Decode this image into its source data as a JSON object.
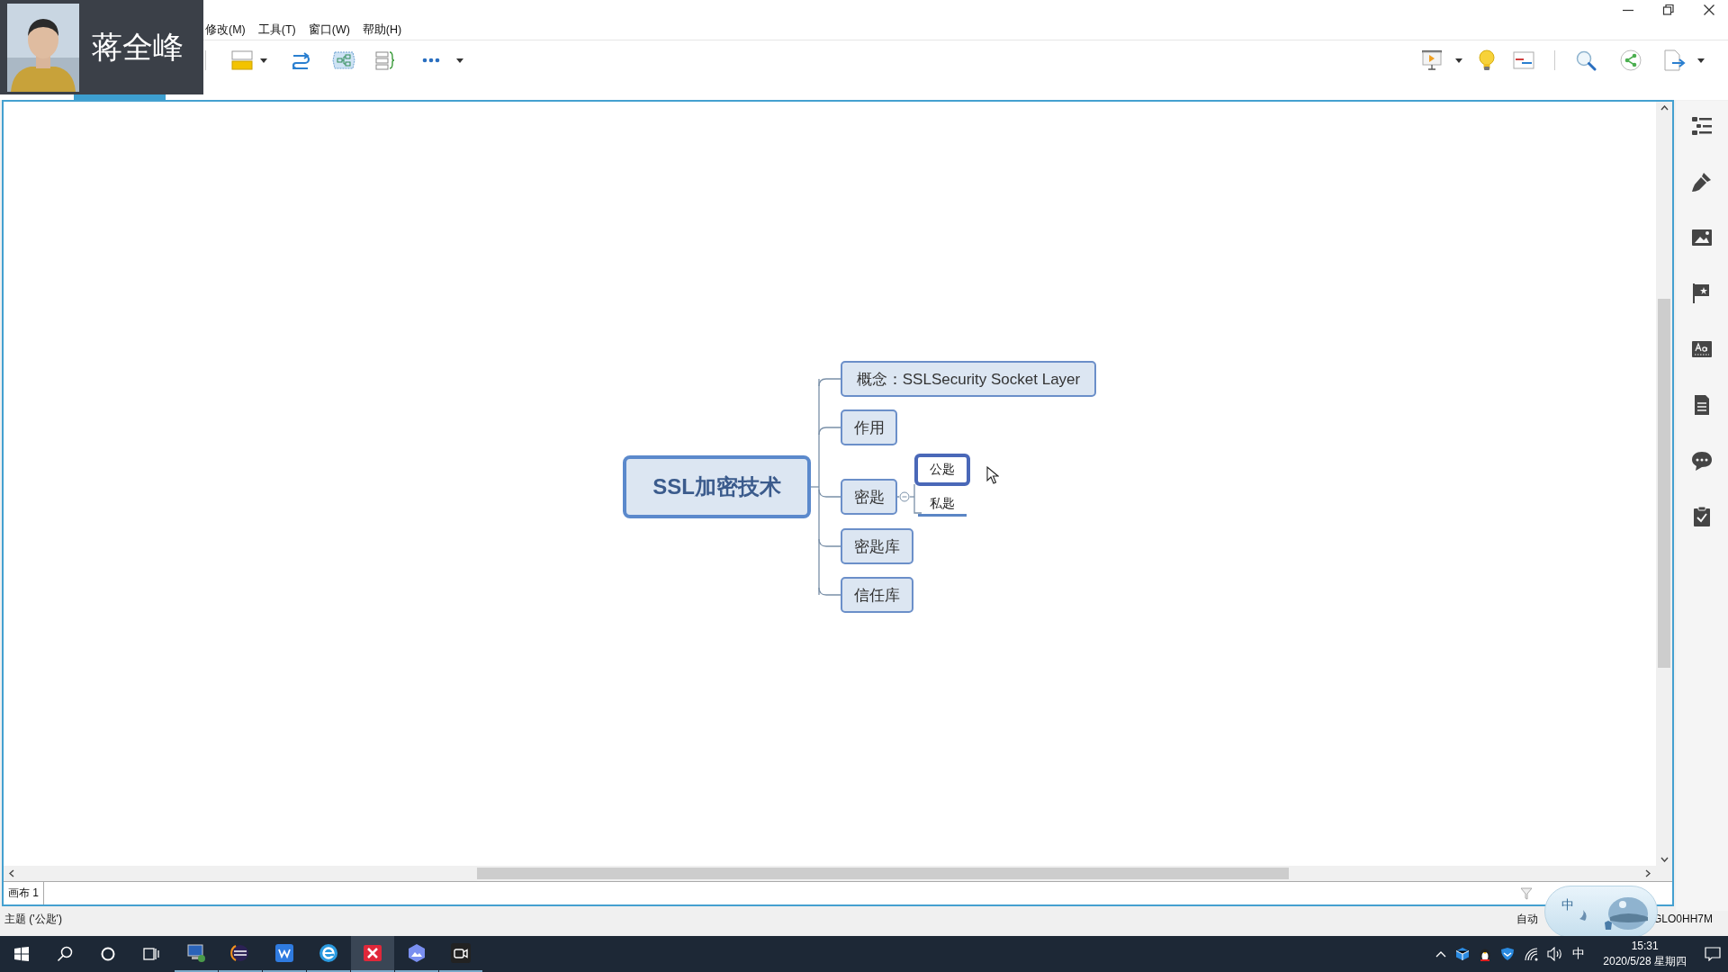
{
  "webcam": {
    "name": "蒋全峰"
  },
  "menu": [
    "修改(M)",
    "工具(T)",
    "窗口(W)",
    "帮助(H)"
  ],
  "mindmap": {
    "root": {
      "text": "SSL加密技术",
      "selected": false,
      "children": [
        {
          "text": "概念：SSLSecurity Socket Layer",
          "selected": false
        },
        {
          "text": "作用",
          "selected": false
        },
        {
          "text": "密匙",
          "selected": false,
          "expanded": true,
          "children": [
            {
              "text": "公匙",
              "selected": true
            },
            {
              "text": "私匙",
              "selected": false
            }
          ]
        },
        {
          "text": "密匙库",
          "selected": false
        },
        {
          "text": "信任库",
          "selected": false
        }
      ]
    }
  },
  "sheets": [
    {
      "label": "画布 1",
      "selected": true
    }
  ],
  "status_bar": {
    "text": "主题 ('公匙')",
    "auto": "自动",
    "code": "GLO0HH7M"
  },
  "ime_widget": {
    "label": "中"
  },
  "taskbar": {
    "apps": [
      {
        "kind": "remote",
        "selected": false
      },
      {
        "kind": "eclipse",
        "selected": false
      },
      {
        "kind": "wps",
        "selected": false
      },
      {
        "kind": "browser",
        "selected": false
      },
      {
        "kind": "xmind",
        "selected": true
      },
      {
        "kind": "photos",
        "selected": false
      },
      {
        "kind": "camera",
        "selected": false
      }
    ],
    "input_mode": "中",
    "time": "15:31",
    "date": "2020/5/28 星期四"
  }
}
